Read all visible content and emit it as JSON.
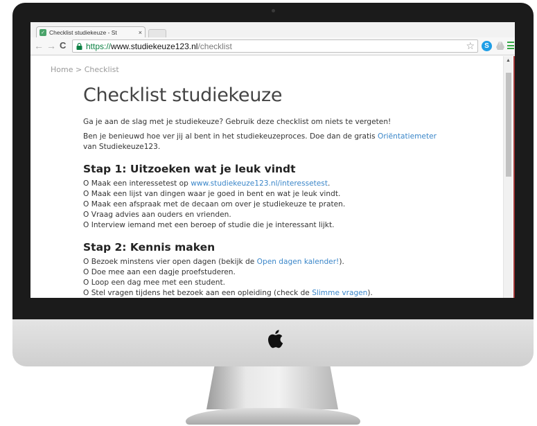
{
  "browser": {
    "tab_title": "Checklist studiekeuze - St",
    "tab_close": "×",
    "url_scheme": "https://",
    "url_domain": "www.studiekeuze123.nl",
    "url_path": "/checklist",
    "skype_label": "S"
  },
  "page": {
    "breadcrumb": "Home > Checklist",
    "title": "Checklist studiekeuze",
    "intro": "Ga je aan de slag met je studiekeuze? Gebruik deze checklist om niets te vergeten!",
    "intro2_before": "Ben je benieuwd hoe ver jij al bent in het studiekeuzeproces. Doe dan de gratis ",
    "intro2_link": "Oriëntatiemeter",
    "intro2_after": "van Studiekeuze123.",
    "step1": {
      "heading": "Stap 1: Uitzoeken wat je leuk vindt",
      "item1_before": "O Maak een interessetest op ",
      "item1_link": "www.studiekeuze123.nl/interessetest",
      "item1_after": ".",
      "item2": "O Maak een lijst van dingen waar je goed in bent en wat je leuk vindt.",
      "item3": "O Maak een afspraak met de decaan om over je studiekeuze te praten.",
      "item4": "O Vraag advies aan ouders en vrienden.",
      "item5": "O Interview iemand met een beroep of studie die je interessant lijkt."
    },
    "step2": {
      "heading": "Stap 2: Kennis maken",
      "item1_before": "O Bezoek minstens vier open dagen (bekijk de ",
      "item1_link": "Open dagen kalender!",
      "item1_after": ").",
      "item2": "O Doe mee aan een dagje proefstuderen.",
      "item3": "O Loop een dag mee met een student.",
      "item4_before": "O Stel vragen tijdens het bezoek aan een opleiding (check de ",
      "item4_link": "Slimme vragen",
      "item4_after": ")."
    }
  },
  "colors": {
    "link": "#3a86c9",
    "secure_green": "#0b8043",
    "favicon": "#4aa36a",
    "bezel": "#1b1b1b"
  },
  "icons": [
    "back-arrow-icon",
    "forward-arrow-icon",
    "reload-icon",
    "lock-icon",
    "star-icon",
    "skype-icon",
    "google-drive-icon",
    "menu-icon",
    "apple-logo-icon"
  ]
}
